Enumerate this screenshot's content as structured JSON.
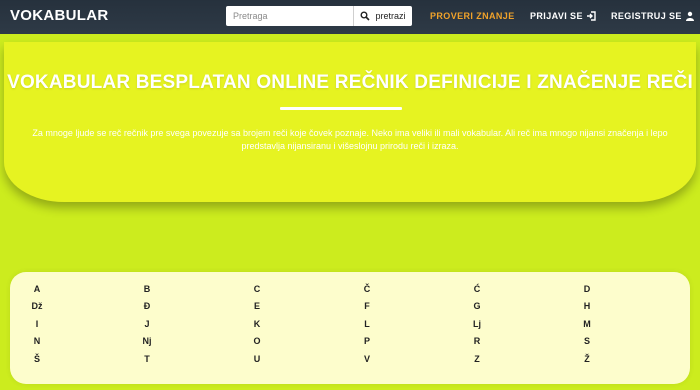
{
  "navbar": {
    "brand": "VOKABULAR",
    "search_placeholder": "Pretraga",
    "search_button": "pretrazi",
    "links": {
      "quiz": "PROVERI ZNANJE",
      "login": "PRIJAVI SE",
      "register": "REGISTRUJ SE"
    }
  },
  "hero": {
    "title": "VOKABULAR BESPLATAN ONLINE REČNIK DEFINICIJE I ZNAČENJE REČI",
    "text": "Za mnoge ljude se reč rečnik pre svega povezuje sa brojem reči koje čovek poznaje. Neko ima veliki ili mali vokabular. Ali reč ima mnogo nijansi značenja i lepo predstavlja nijansiranu i višeslojnu prirodu reči i izraza."
  },
  "alphabet": [
    "A",
    "B",
    "C",
    "Č",
    "Ć",
    "D",
    "Dž",
    "Đ",
    "E",
    "F",
    "G",
    "H",
    "I",
    "J",
    "K",
    "L",
    "Lj",
    "M",
    "N",
    "Nj",
    "O",
    "P",
    "R",
    "S",
    "Š",
    "T",
    "U",
    "V",
    "Z",
    "Ž"
  ],
  "colors": {
    "navbar": "#26313d",
    "background": "#ccec1e",
    "hero": "#e6f321",
    "accent": "#f0a22a",
    "panel": "#fdfdcc"
  }
}
